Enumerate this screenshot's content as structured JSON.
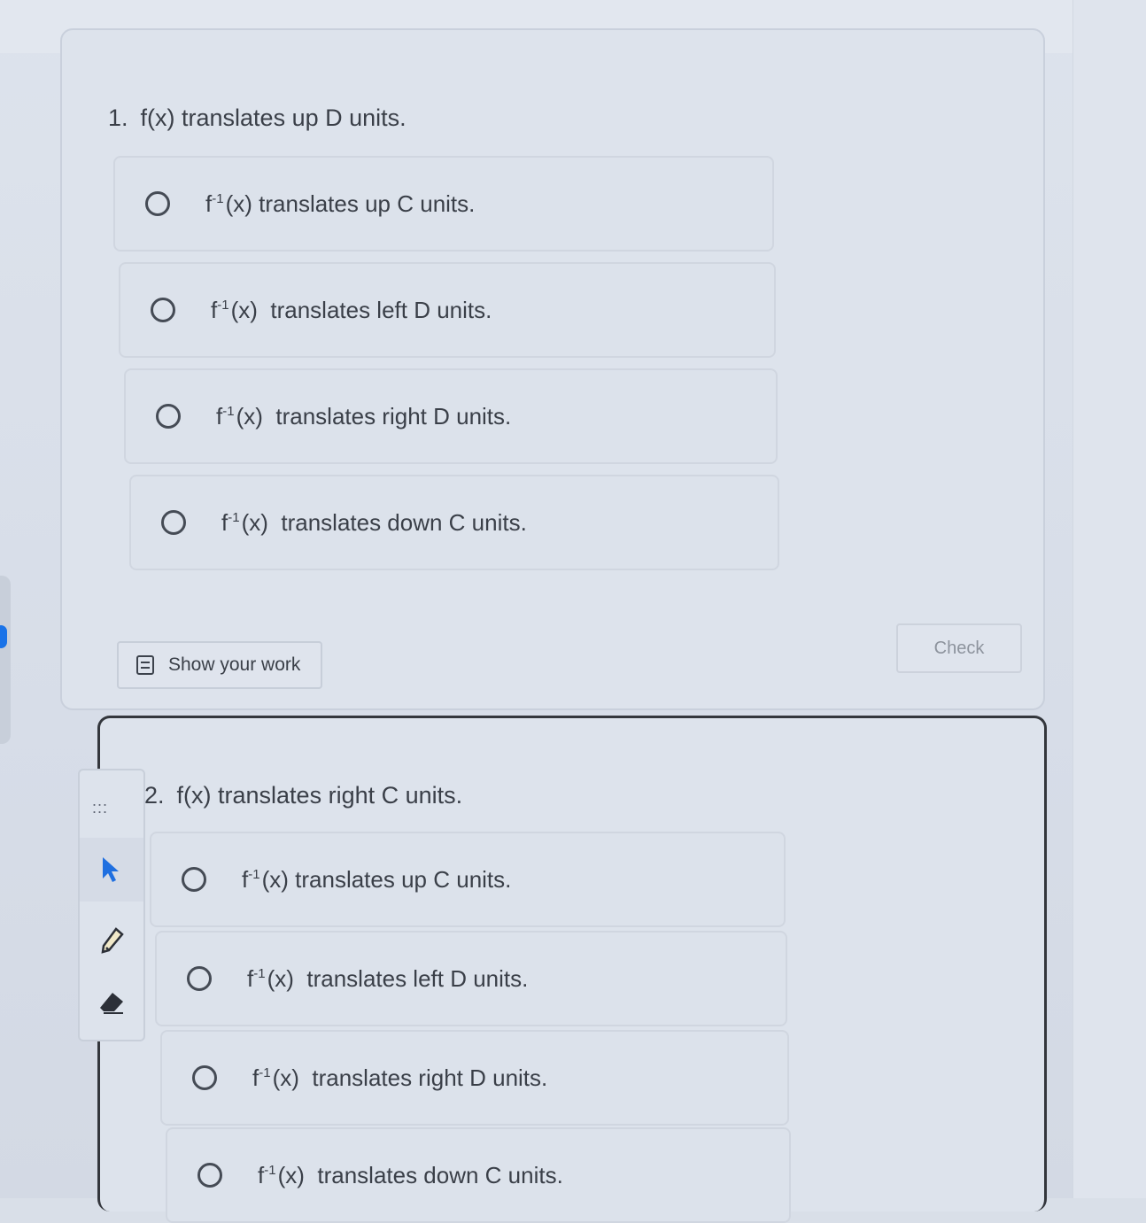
{
  "question1": {
    "number": "1.",
    "prompt": "f(x) translates up D units.",
    "options": [
      {
        "fn": "f",
        "sup": "-1",
        "arg": "(x)",
        "text": "translates up C units."
      },
      {
        "fn": "f",
        "sup": "-1",
        "arg": "(x)",
        "text": "translates left D units."
      },
      {
        "fn": "f",
        "sup": "-1",
        "arg": "(x)",
        "text": "translates right D units."
      },
      {
        "fn": "f",
        "sup": "-1",
        "arg": "(x)",
        "text": "translates down C units."
      }
    ],
    "show_work_label": "Show your work",
    "check_label": "Check"
  },
  "question2": {
    "number": "2.",
    "prompt": "f(x) translates right C units.",
    "options": [
      {
        "fn": "f",
        "sup": "-1",
        "arg": "(x)",
        "text": "translates up C units."
      },
      {
        "fn": "f",
        "sup": "-1",
        "arg": "(x)",
        "text": "translates left D units."
      },
      {
        "fn": "f",
        "sup": "-1",
        "arg": "(x)",
        "text": "translates right D units."
      },
      {
        "fn": "f",
        "sup": "-1",
        "arg": "(x)",
        "text": "translates down C units."
      }
    ]
  },
  "tools": {
    "grip_glyph": ":::",
    "items": [
      "pointer-icon",
      "pencil-icon",
      "eraser-icon"
    ]
  },
  "colors": {
    "accent": "#1a73e8",
    "active_border": "#33363c"
  }
}
